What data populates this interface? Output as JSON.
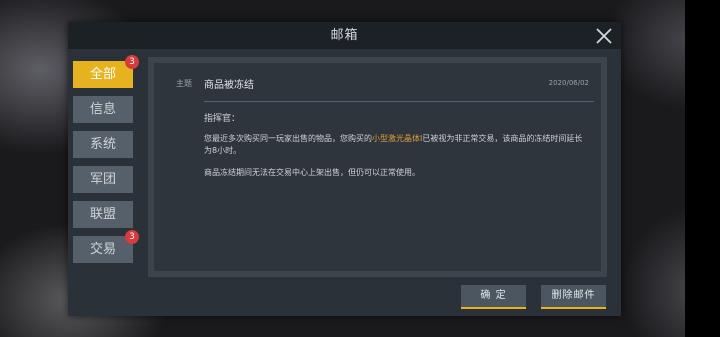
{
  "window": {
    "title": "邮箱"
  },
  "tabs": [
    {
      "label": "全部",
      "badge": "3",
      "active": true
    },
    {
      "label": "信息",
      "badge": null,
      "active": false
    },
    {
      "label": "系统",
      "badge": null,
      "active": false
    },
    {
      "label": "军团",
      "badge": null,
      "active": false
    },
    {
      "label": "联盟",
      "badge": null,
      "active": false
    },
    {
      "label": "交易",
      "badge": "3",
      "active": false
    }
  ],
  "mail": {
    "subject_label": "主题",
    "subject": "商品被冻结",
    "date": "2020/06/02",
    "salutation": "指挥官：",
    "body_part1": "您最近多次购买同一玩家出售的物品，您购买的",
    "item_name": "小型激光晶体Ⅰ",
    "body_part2": "已被视为非正常交易，该商品的冻结时间延长为8小时。",
    "body_line2": "商品冻结期间无法在交易中心上架出售，但仍可以正常使用。"
  },
  "buttons": {
    "confirm": "确 定",
    "delete": "删除邮件"
  },
  "colors": {
    "accent": "#e6b21f",
    "highlight": "#e0a23a",
    "badge": "#d93b3b"
  },
  "icons": {
    "close": "close-icon"
  }
}
